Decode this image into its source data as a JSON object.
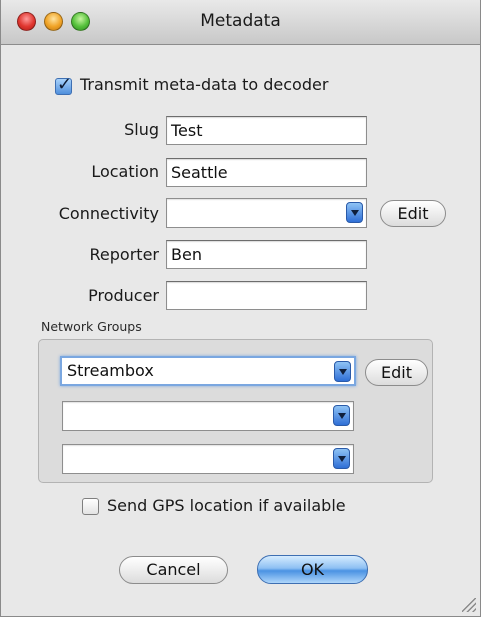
{
  "window": {
    "title": "Metadata"
  },
  "transmit": {
    "label": "Transmit meta-data to decoder",
    "checked": true
  },
  "fields": {
    "slug": {
      "label": "Slug",
      "value": "Test"
    },
    "location": {
      "label": "Location",
      "value": "Seattle"
    },
    "connectivity": {
      "label": "Connectivity",
      "value": "",
      "edit_label": "Edit"
    },
    "reporter": {
      "label": "Reporter",
      "value": "Ben"
    },
    "producer": {
      "label": "Producer",
      "value": ""
    }
  },
  "network_groups": {
    "title": "Network Groups",
    "selects": [
      "Streambox",
      "",
      ""
    ],
    "edit_label": "Edit"
  },
  "gps": {
    "label": "Send GPS location if available",
    "checked": false
  },
  "buttons": {
    "cancel": "Cancel",
    "ok": "OK"
  }
}
